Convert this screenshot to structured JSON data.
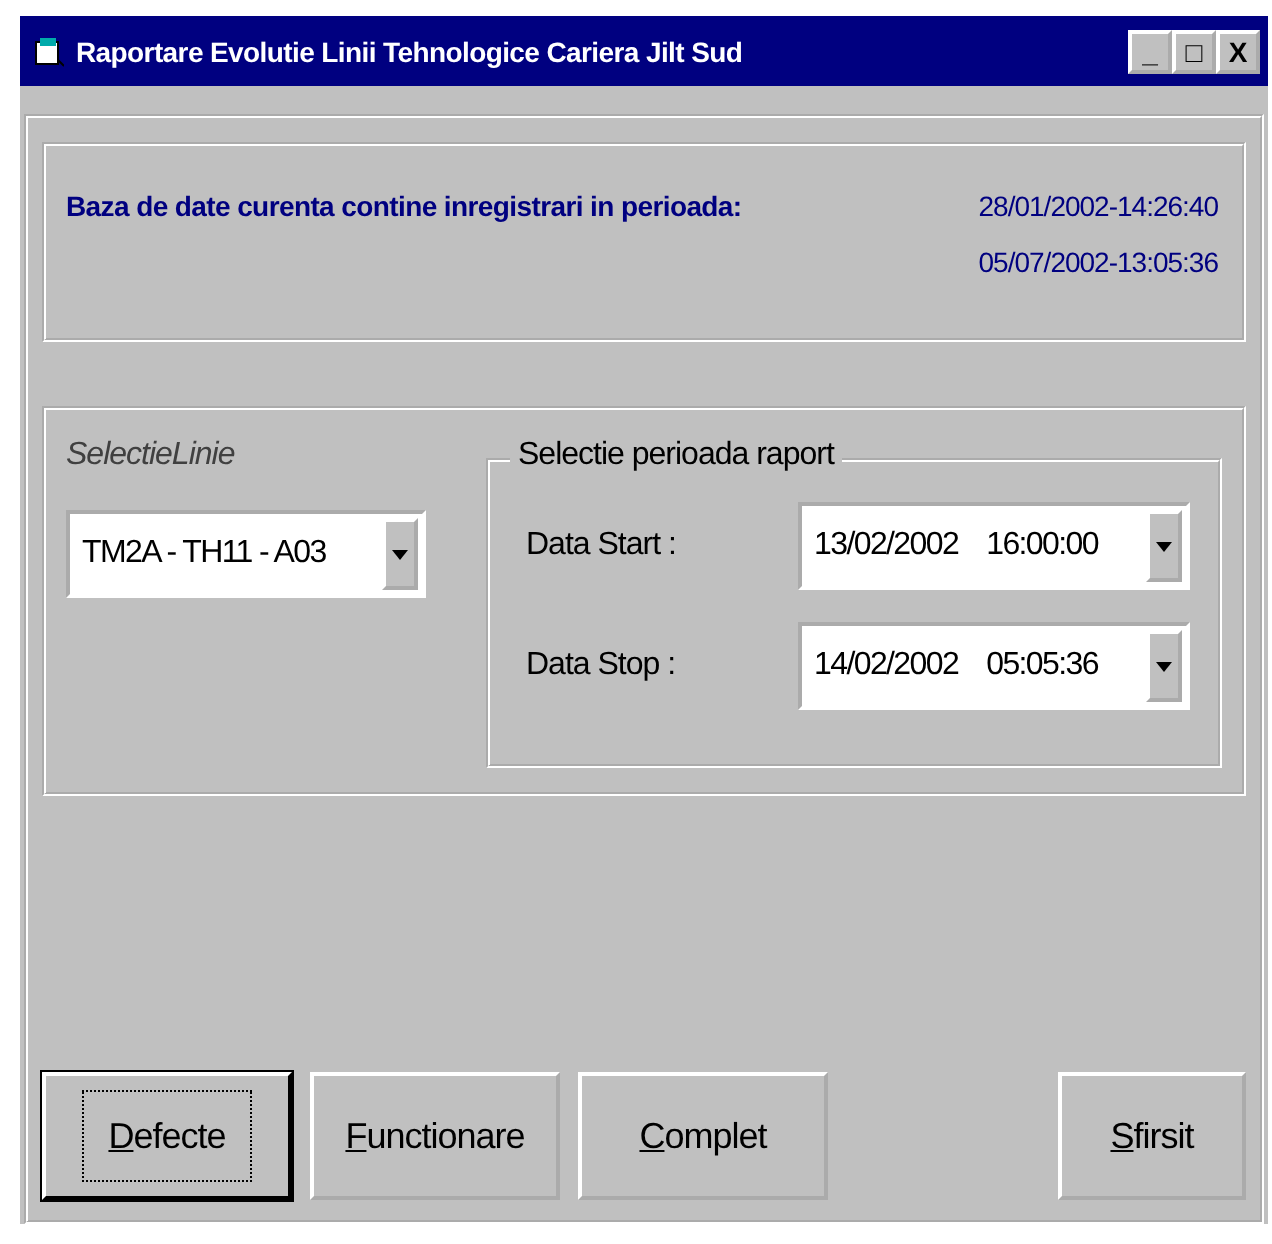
{
  "window": {
    "title": "Raportare Evolutie Linii Tehnologice Cariera Jilt Sud",
    "controls": [
      "_",
      "□",
      "X"
    ]
  },
  "info": {
    "label": "Baza de date curenta contine inregistrari in perioada:",
    "dates": [
      "28/01/2002-14:26:40",
      "05/07/2002-13:05:36"
    ]
  },
  "line_selection": {
    "label": "SelectieLinie",
    "value": "TM2A - TH11 - A03"
  },
  "period_group": {
    "title": "Selectie perioada raport",
    "fields": [
      {
        "label": "Data Start :",
        "date": "13/02/2002",
        "time": "16:00:00"
      },
      {
        "label": "Data Stop :",
        "date": "14/02/2002",
        "time": "05:05:36"
      }
    ]
  },
  "buttons": [
    {
      "accel": "D",
      "rest": "efecte",
      "default": true
    },
    {
      "accel": "F",
      "rest": "unctionare",
      "default": false
    },
    {
      "accel": "C",
      "rest": "omplet",
      "default": false
    },
    {
      "accel": "S",
      "rest": "firsit",
      "default": false
    }
  ]
}
